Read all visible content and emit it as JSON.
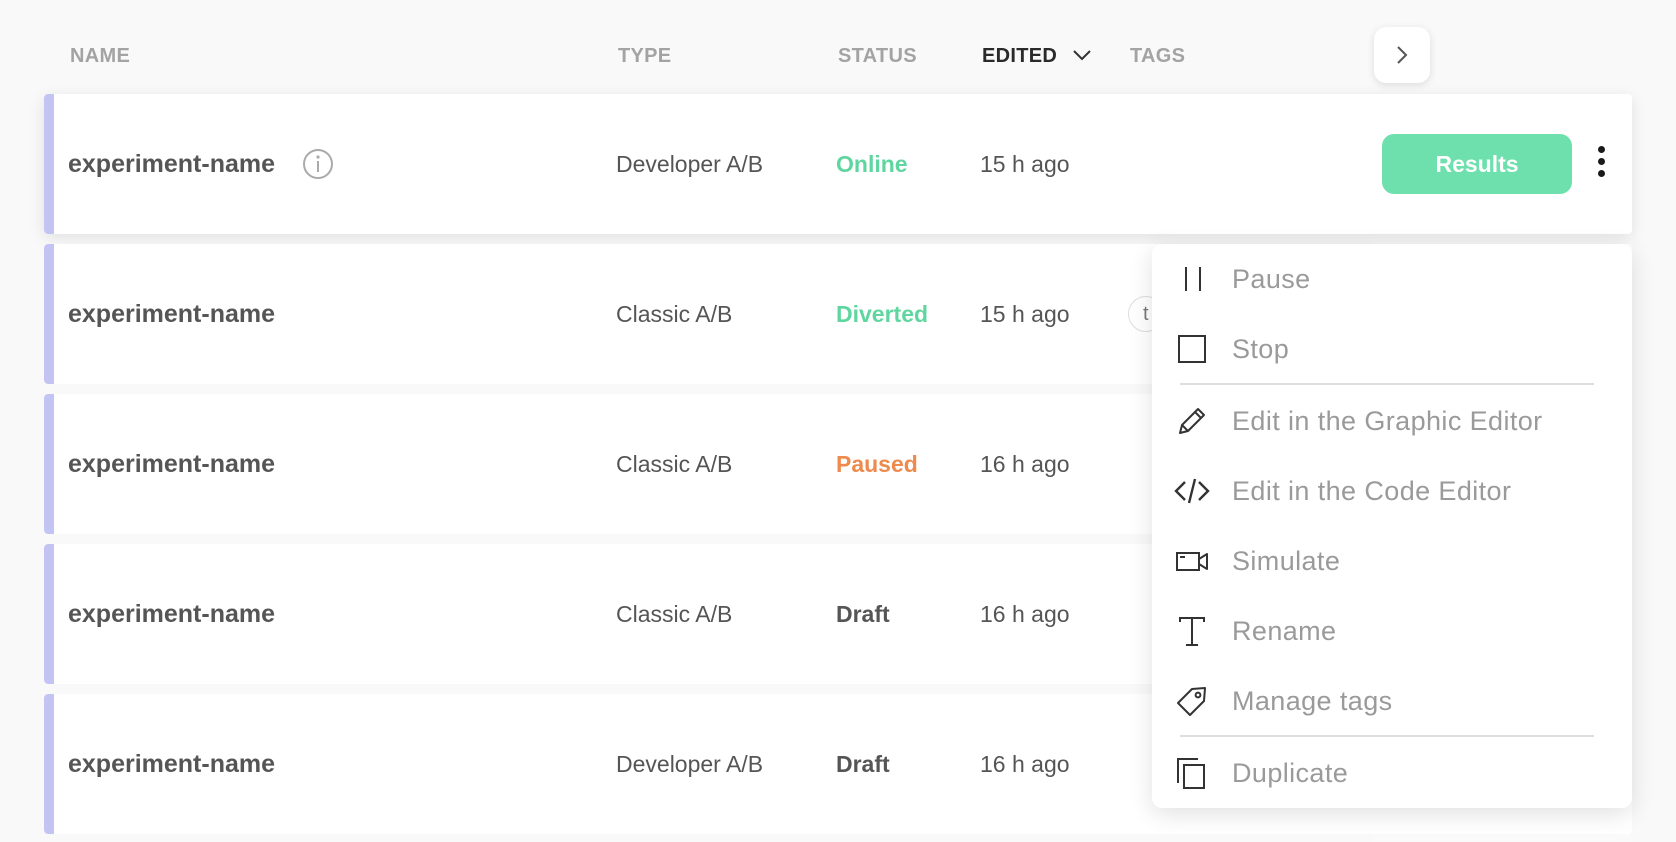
{
  "columns": {
    "name": "NAME",
    "type": "TYPE",
    "status": "STATUS",
    "edited": "EDITED",
    "tags": "TAGS"
  },
  "rows": [
    {
      "name": "experiment-name",
      "type": "Developer A/B",
      "status": "Online",
      "status_color": "#5fd6a0",
      "edited": "15 h ago"
    },
    {
      "name": "experiment-name",
      "type": "Classic A/B",
      "status": "Diverted",
      "status_color": "#5fd6a0",
      "edited": "15 h ago",
      "tag": "t"
    },
    {
      "name": "experiment-name",
      "type": "Classic A/B",
      "status": "Paused",
      "status_color": "#ee8a4e",
      "edited": "16 h ago"
    },
    {
      "name": "experiment-name",
      "type": "Classic A/B",
      "status": "Draft",
      "status_color": "#555555",
      "edited": "16 h ago"
    },
    {
      "name": "experiment-name",
      "type": "Developer A/B",
      "status": "Draft",
      "status_color": "#555555",
      "edited": "16 h ago"
    }
  ],
  "actions": {
    "results_label": "Results"
  },
  "menu": {
    "items": [
      {
        "label": "Pause",
        "icon": "pause-icon"
      },
      {
        "label": "Stop",
        "icon": "stop-icon"
      },
      {
        "label": "Edit in the Graphic Editor",
        "icon": "pencil-icon"
      },
      {
        "label": "Edit in the Code Editor",
        "icon": "code-icon"
      },
      {
        "label": "Simulate",
        "icon": "video-camera-icon"
      },
      {
        "label": "Rename",
        "icon": "text-icon"
      },
      {
        "label": "Manage tags",
        "icon": "tag-icon"
      },
      {
        "label": "Duplicate",
        "icon": "duplicate-icon"
      }
    ]
  },
  "colors": {
    "accent_bar": "#c3c4f3",
    "results_button": "#6ee0ad",
    "status_online": "#5fd6a0",
    "status_paused": "#ee8a4e"
  }
}
